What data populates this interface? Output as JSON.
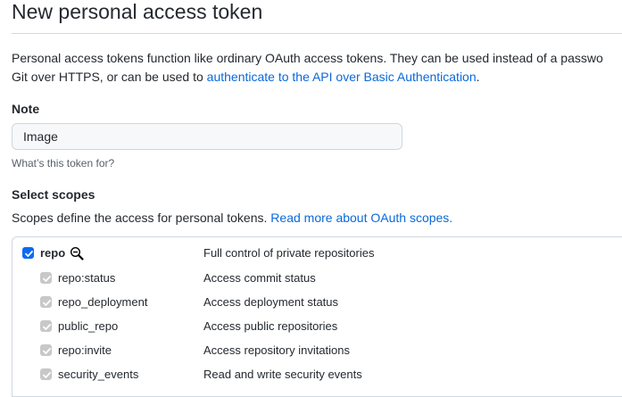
{
  "page": {
    "title": "New personal access token",
    "intro_line1": "Personal access tokens function like ordinary OAuth access tokens. They can be used instead of a passwo",
    "intro_line2_prefix": "Git over HTTPS, or can be used to ",
    "intro_link": "authenticate to the API over Basic Authentication",
    "intro_line2_suffix": "."
  },
  "note": {
    "label": "Note",
    "value": "Image",
    "hint": "What’s this token for?"
  },
  "scopes": {
    "label": "Select scopes",
    "description": "Scopes define the access for personal tokens.",
    "link": "Read more about OAuth scopes.",
    "rows": [
      {
        "name": "repo",
        "description": "Full control of private repositories",
        "checked": true,
        "disabled": false,
        "parent": true
      },
      {
        "name": "repo:status",
        "description": "Access commit status",
        "checked": true,
        "disabled": true,
        "parent": false
      },
      {
        "name": "repo_deployment",
        "description": "Access deployment status",
        "checked": true,
        "disabled": true,
        "parent": false
      },
      {
        "name": "public_repo",
        "description": "Access public repositories",
        "checked": true,
        "disabled": true,
        "parent": false
      },
      {
        "name": "repo:invite",
        "description": "Access repository invitations",
        "checked": true,
        "disabled": true,
        "parent": false
      },
      {
        "name": "security_events",
        "description": "Read and write security events",
        "checked": true,
        "disabled": true,
        "parent": false
      }
    ]
  },
  "colors": {
    "link": "#0969da",
    "checkbox_checked": "#0b6bf2",
    "checkbox_disabled": "#c8c8c8"
  },
  "icons": {
    "check": "check-icon",
    "cursor": "zoom-out-cursor-icon"
  }
}
